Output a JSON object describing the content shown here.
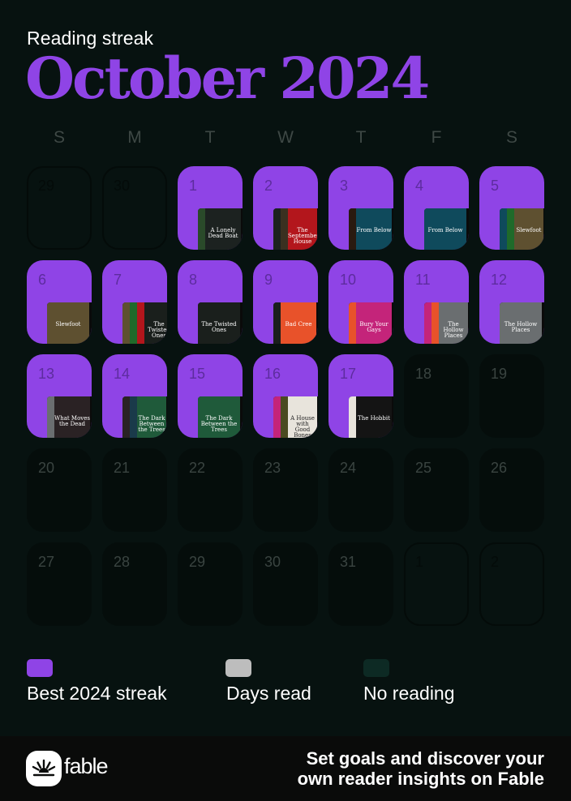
{
  "header": {
    "subtitle": "Reading streak",
    "title": "October 2024"
  },
  "colors": {
    "background": "#071210",
    "streak": "#8f44e6",
    "days_read": "#bdbdbd",
    "no_reading": "#0d2a24",
    "footer": "#0a0b0a"
  },
  "weekdays": [
    "S",
    "M",
    "T",
    "W",
    "T",
    "F",
    "S"
  ],
  "calendar": [
    {
      "day": "29",
      "state": "outside",
      "books": []
    },
    {
      "day": "30",
      "state": "outside",
      "books": []
    },
    {
      "day": "1",
      "state": "streak",
      "books": [
        {
          "title": "",
          "color": "#2a4a2a"
        },
        {
          "title": "A Lonely Dead Boat",
          "color": "#1c2220"
        }
      ]
    },
    {
      "day": "2",
      "state": "streak",
      "books": [
        {
          "title": "",
          "color": "#1c2220"
        },
        {
          "title": "",
          "color": "#3a3020"
        },
        {
          "title": "The September House",
          "color": "#b3161c"
        }
      ]
    },
    {
      "day": "3",
      "state": "streak",
      "books": [
        {
          "title": "",
          "color": "#2a1a10"
        },
        {
          "title": "From Below",
          "color": "#0f4a5c"
        }
      ]
    },
    {
      "day": "4",
      "state": "streak",
      "books": [
        {
          "title": "From Below",
          "color": "#0f4a5c"
        }
      ]
    },
    {
      "day": "5",
      "state": "streak",
      "books": [
        {
          "title": "",
          "color": "#0f4a5c"
        },
        {
          "title": "",
          "color": "#1f6a2a"
        },
        {
          "title": "Slewfoot",
          "color": "#5e5030"
        }
      ]
    },
    {
      "day": "6",
      "state": "streak",
      "books": [
        {
          "title": "Slewfoot",
          "color": "#5e5030"
        }
      ]
    },
    {
      "day": "7",
      "state": "streak",
      "books": [
        {
          "title": "",
          "color": "#5e5030"
        },
        {
          "title": "",
          "color": "#1f6a2a"
        },
        {
          "title": "",
          "color": "#b3161c"
        },
        {
          "title": "The Twisted Ones",
          "color": "#1a1f1c"
        }
      ]
    },
    {
      "day": "8",
      "state": "streak",
      "books": [
        {
          "title": "The Twisted Ones",
          "color": "#1a1f1c"
        }
      ]
    },
    {
      "day": "9",
      "state": "streak",
      "books": [
        {
          "title": "",
          "color": "#1a1f1c"
        },
        {
          "title": "Bad Cree",
          "color": "#e8522a"
        }
      ]
    },
    {
      "day": "10",
      "state": "streak",
      "books": [
        {
          "title": "",
          "color": "#e8522a"
        },
        {
          "title": "Bury Your Gays",
          "color": "#c4247a"
        }
      ]
    },
    {
      "day": "11",
      "state": "streak",
      "books": [
        {
          "title": "",
          "color": "#c4247a"
        },
        {
          "title": "",
          "color": "#e8522a"
        },
        {
          "title": "The Hollow Places",
          "color": "#6a6e70"
        }
      ]
    },
    {
      "day": "12",
      "state": "streak",
      "books": [
        {
          "title": "The Hollow Places",
          "color": "#6a6e70"
        }
      ]
    },
    {
      "day": "13",
      "state": "streak",
      "books": [
        {
          "title": "",
          "color": "#6a6e70"
        },
        {
          "title": "What Moves the Dead",
          "color": "#2a2224"
        }
      ]
    },
    {
      "day": "14",
      "state": "streak",
      "books": [
        {
          "title": "",
          "color": "#2a2224"
        },
        {
          "title": "",
          "color": "#1a3a4a"
        },
        {
          "title": "The Dark Between the Trees",
          "color": "#1f5a3a"
        }
      ]
    },
    {
      "day": "15",
      "state": "streak",
      "books": [
        {
          "title": "The Dark Between the Trees",
          "color": "#1f5a3a"
        }
      ]
    },
    {
      "day": "16",
      "state": "streak",
      "books": [
        {
          "title": "",
          "color": "#c4247a"
        },
        {
          "title": "",
          "color": "#4a4a20"
        },
        {
          "title": "A House with Good Bones",
          "color": "#e8e4dc"
        }
      ]
    },
    {
      "day": "17",
      "state": "streak",
      "books": [
        {
          "title": "",
          "color": "#e8e4dc"
        },
        {
          "title": "The Hobbit",
          "color": "#141414"
        }
      ]
    },
    {
      "day": "18",
      "state": "noread",
      "books": []
    },
    {
      "day": "19",
      "state": "noread",
      "books": []
    },
    {
      "day": "20",
      "state": "noread",
      "books": []
    },
    {
      "day": "21",
      "state": "noread",
      "books": []
    },
    {
      "day": "22",
      "state": "noread",
      "books": []
    },
    {
      "day": "23",
      "state": "noread",
      "books": []
    },
    {
      "day": "24",
      "state": "noread",
      "books": []
    },
    {
      "day": "25",
      "state": "noread",
      "books": []
    },
    {
      "day": "26",
      "state": "noread",
      "books": []
    },
    {
      "day": "27",
      "state": "noread",
      "books": []
    },
    {
      "day": "28",
      "state": "noread",
      "books": []
    },
    {
      "day": "29",
      "state": "noread",
      "books": []
    },
    {
      "day": "30",
      "state": "noread",
      "books": []
    },
    {
      "day": "31",
      "state": "noread",
      "books": []
    },
    {
      "day": "1",
      "state": "outside",
      "books": []
    },
    {
      "day": "2",
      "state": "outside",
      "books": []
    }
  ],
  "legend": [
    {
      "label": "Best 2024 streak",
      "color": "#8f44e6"
    },
    {
      "label": "Days read",
      "color": "#bdbdbd"
    },
    {
      "label": "No reading",
      "color": "#0d2a24"
    }
  ],
  "footer": {
    "logo_icon": "sunrise-icon",
    "brand": "fable",
    "cta_line1": "Set goals and discover your",
    "cta_line2": "own reader insights on Fable"
  }
}
